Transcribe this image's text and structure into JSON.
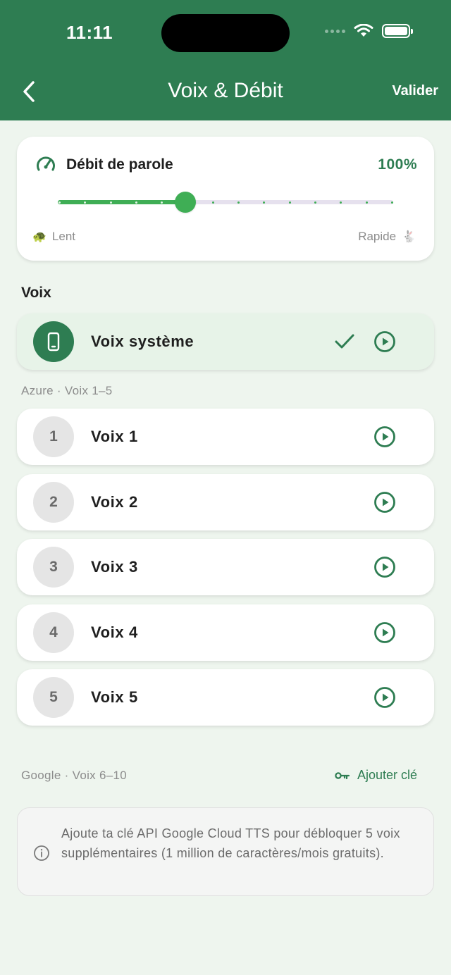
{
  "status_bar": {
    "time": "11:11"
  },
  "nav": {
    "title": "Voix & Débit",
    "confirm_label": "Valider",
    "back_icon": "chevron-left-icon"
  },
  "speech_rate": {
    "title": "Débit de parole",
    "value_label": "100%",
    "value_fraction": 0.38,
    "tick_count": 14,
    "slow_label": "Lent",
    "slow_emoji": "🐢",
    "fast_label": "Rapide",
    "fast_emoji": "🐇"
  },
  "voices": {
    "section_title": "Voix",
    "system_voice": {
      "name": "Voix système",
      "selected": true
    },
    "azure_group": {
      "label": "Azure · Voix 1–5",
      "items": [
        {
          "number": "1",
          "name": "Voix 1"
        },
        {
          "number": "2",
          "name": "Voix 2"
        },
        {
          "number": "3",
          "name": "Voix 3"
        },
        {
          "number": "4",
          "name": "Voix 4"
        },
        {
          "number": "5",
          "name": "Voix 5"
        }
      ]
    },
    "google_group": {
      "label": "Google · Voix 6–10",
      "add_key_label": "Ajouter clé",
      "info_text": "Ajoute ta clé API Google Cloud TTS pour débloquer 5 voix supplémentaires (1 million de caractères/mois gratuits)."
    }
  },
  "colors": {
    "primary": "#2E7D52",
    "slider_active": "#3FAE55",
    "slider_inactive": "#E6E1EE",
    "background": "#EEF5EE",
    "selected_row": "#E7F3E8"
  }
}
